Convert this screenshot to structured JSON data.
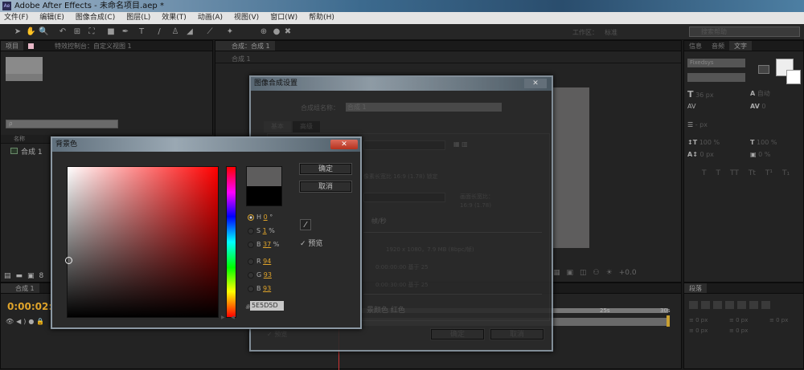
{
  "titlebar": {
    "app_icon": "Ae",
    "title": "Adobe After Effects - 未命名项目.aep *"
  },
  "menu": [
    "文件(F)",
    "编辑(E)",
    "图像合成(C)",
    "图层(L)",
    "效果(T)",
    "动画(A)",
    "视图(V)",
    "窗口(W)",
    "帮助(H)"
  ],
  "toolbar": {
    "workspace_label": "工作区：",
    "workspace_value": "标准",
    "search_placeholder": "搜索帮助"
  },
  "project_panel": {
    "tab": "项目",
    "effects_tab": "特效控制台：自定义视图 1",
    "search_placeholder": "ρ",
    "column_name": "名称",
    "items": [
      {
        "name": "合成 1"
      }
    ],
    "bpc": "8"
  },
  "comp_panel": {
    "tab": "合成：合成 1",
    "breadcrumb": "合成 1",
    "exposure": "+0.0"
  },
  "timeline": {
    "tab": "合成 1",
    "timecode": "0:00:02:1",
    "ticks": [
      "25s",
      "30s"
    ]
  },
  "right_panel": {
    "tabs": [
      "信息",
      "音频",
      "文字"
    ],
    "font": "Fixedsys",
    "font_size": "36 px",
    "leading": "自动",
    "tracking": "0",
    "stroke": "- px",
    "v_scale": "100 %",
    "h_scale": "100 %",
    "baseline": "0 px",
    "tsume": "0 %",
    "styles": [
      "T",
      "T",
      "TT",
      "Tt",
      "T¹",
      "T₁"
    ]
  },
  "paragraph_panel": {
    "tab": "段落",
    "indents": [
      "0 px",
      "0 px",
      "0 px",
      "0 px",
      "0 px"
    ]
  },
  "comp_settings": {
    "title": "图像合成设置",
    "name_label": "合成组名称：",
    "name_value": "合成 1",
    "tabs": [
      "基本",
      "高级"
    ],
    "pixel_aspect": "像素长宽比 16:9 (1.78) 锁定",
    "frame_aspect_label": "画面长宽比：",
    "frame_aspect": "16:9 (1.78)",
    "fps_unit": "帧/秒",
    "resolution": "1920 x 1080，7.9 MB (8bpc/帧)",
    "start_tc": "0:00:00:00  基于 25",
    "duration": "0:00:30:00  基于 25",
    "bg_color": "景颜色  红色",
    "preview": "预览",
    "ok": "确定",
    "cancel": "取消"
  },
  "color_picker": {
    "title": "背景色",
    "ok": "确定",
    "cancel": "取消",
    "h_label": "H",
    "h": "0",
    "h_unit": "°",
    "s_label": "S",
    "s": "1",
    "s_unit": "%",
    "b_label": "B",
    "b": "37",
    "b_unit": "%",
    "r_label": "R",
    "r": "94",
    "g_label": "G",
    "g": "93",
    "bb_label": "B",
    "bb": "93",
    "hex_label": "#",
    "hex": "5E5D5D",
    "preview": "预览",
    "new_color": "#5e5d5d",
    "old_color": "#000000",
    "hue": "#ff0000"
  }
}
